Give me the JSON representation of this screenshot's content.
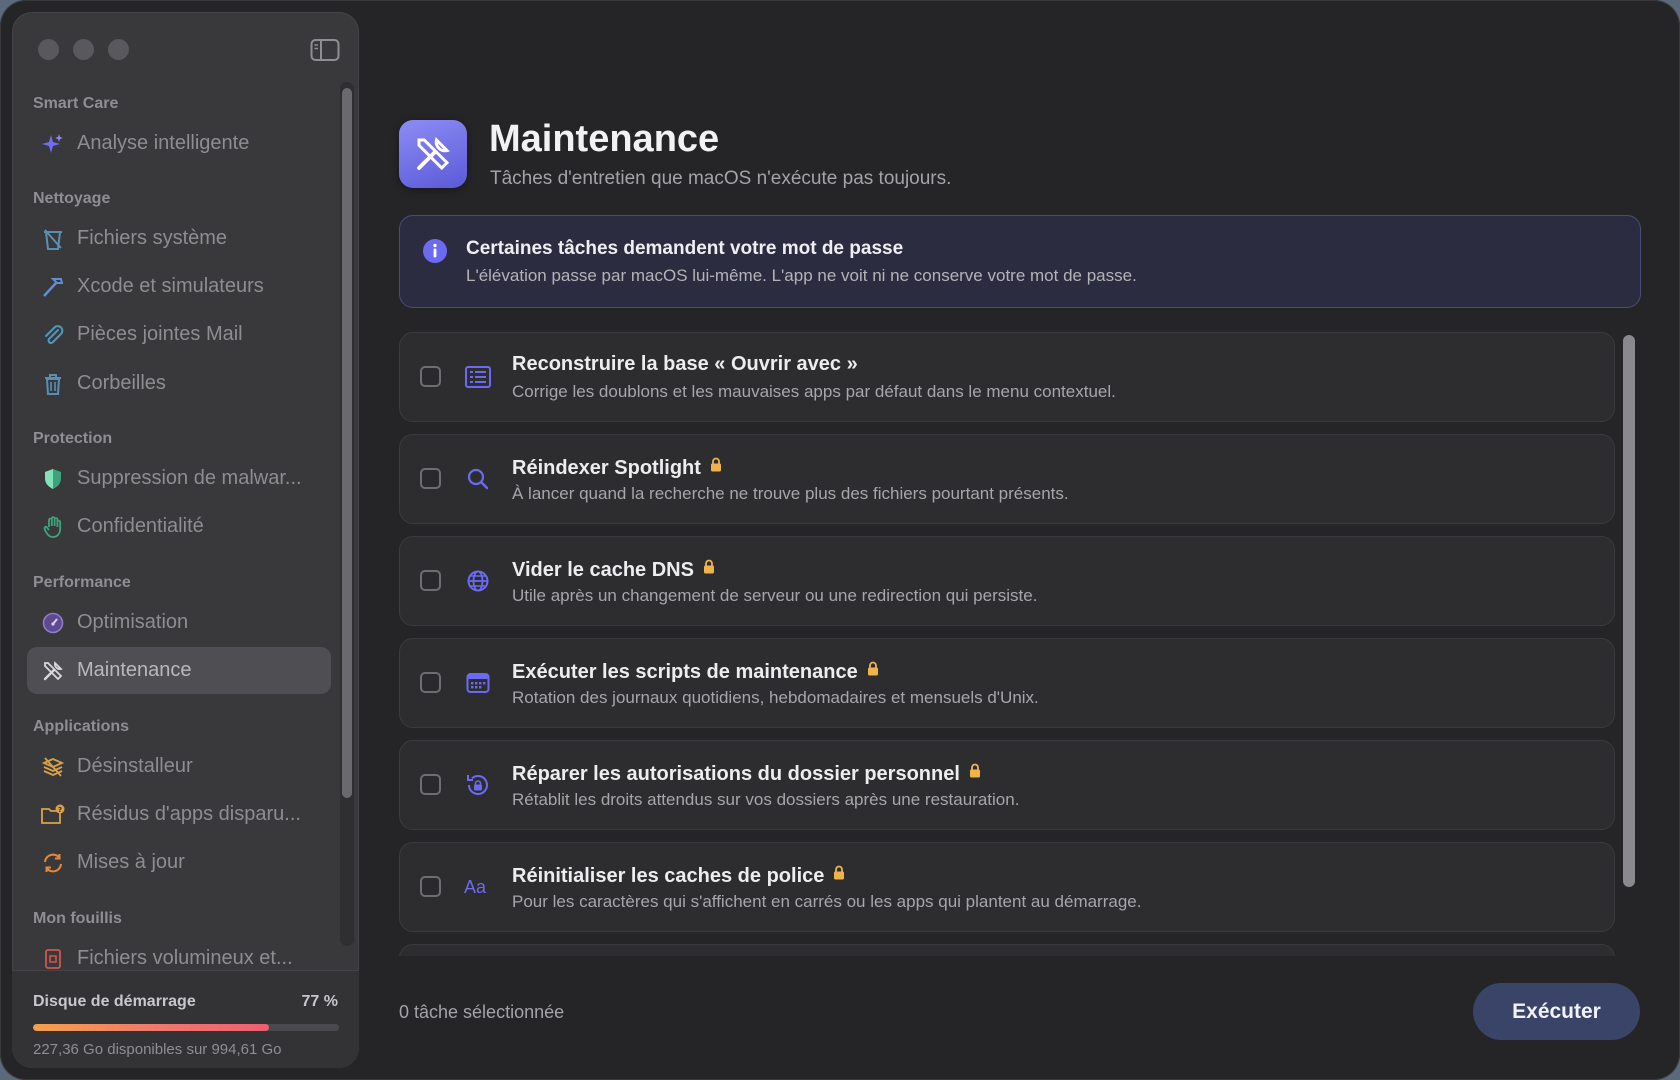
{
  "sidebar": {
    "sections": [
      {
        "title": "Smart Care",
        "items": [
          {
            "label": "Analyse intelligente",
            "icon": "sparkles-icon"
          }
        ]
      },
      {
        "title": "Nettoyage",
        "items": [
          {
            "label": "Fichiers système",
            "icon": "trash-doc-icon"
          },
          {
            "label": "Xcode et simulateurs",
            "icon": "hammer-icon"
          },
          {
            "label": "Pièces jointes Mail",
            "icon": "paperclip-icon"
          },
          {
            "label": "Corbeilles",
            "icon": "trash-icon"
          }
        ]
      },
      {
        "title": "Protection",
        "items": [
          {
            "label": "Suppression de malwar...",
            "icon": "shield-icon"
          },
          {
            "label": "Confidentialité",
            "icon": "hand-icon"
          }
        ]
      },
      {
        "title": "Performance",
        "items": [
          {
            "label": "Optimisation",
            "icon": "gauge-icon"
          },
          {
            "label": "Maintenance",
            "icon": "tools-icon",
            "selected": true
          }
        ]
      },
      {
        "title": "Applications",
        "items": [
          {
            "label": "Désinstalleur",
            "icon": "uninstall-icon"
          },
          {
            "label": "Résidus d'apps disparu...",
            "icon": "folder-question-icon"
          },
          {
            "label": "Mises à jour",
            "icon": "refresh-icon"
          }
        ]
      },
      {
        "title": "Mon fouillis",
        "items": [
          {
            "label": "Fichiers volumineux et...",
            "icon": "large-file-icon"
          }
        ]
      }
    ],
    "disk": {
      "title": "Disque de démarrage",
      "percent_label": "77 %",
      "used_fraction": 0.77,
      "free_label": "227,36 Go disponibles sur 994,61 Go"
    }
  },
  "header": {
    "title": "Maintenance",
    "subtitle": "Tâches d'entretien que macOS n'exécute pas toujours."
  },
  "banner": {
    "title": "Certaines tâches demandent votre mot de passe",
    "text": "L'élévation passe par macOS lui-même. L'app ne voit ni ne conserve votre mot de passe."
  },
  "tasks": [
    {
      "title": "Reconstruire la base « Ouvrir avec »",
      "desc": "Corrige les doublons et les mauvaises apps par défaut dans le menu contextuel.",
      "locked": false,
      "checked": false,
      "icon": "list-icon"
    },
    {
      "title": "Réindexer Spotlight",
      "desc": "À lancer quand la recherche ne trouve plus des fichiers pourtant présents.",
      "locked": true,
      "checked": false,
      "icon": "search-icon"
    },
    {
      "title": "Vider le cache DNS",
      "desc": "Utile après un changement de serveur ou une redirection qui persiste.",
      "locked": true,
      "checked": false,
      "icon": "globe-icon"
    },
    {
      "title": "Exécuter les scripts de maintenance",
      "desc": "Rotation des journaux quotidiens, hebdomadaires et mensuels d'Unix.",
      "locked": true,
      "checked": false,
      "icon": "calendar-icon"
    },
    {
      "title": "Réparer les autorisations du dossier personnel",
      "desc": "Rétablit les droits attendus sur vos dossiers après une restauration.",
      "locked": true,
      "checked": false,
      "icon": "lock-rotate-icon"
    },
    {
      "title": "Réinitialiser les caches de police",
      "desc": "Pour les caractères qui s'affichent en carrés ou les apps qui plantent au démarrage.",
      "locked": true,
      "checked": false,
      "icon": "font-icon"
    }
  ],
  "footer": {
    "status": "0 tâche sélectionnée",
    "run_label": "Exécuter"
  },
  "colors": {
    "accent": "#6b6af0",
    "lock": "#f0b34a",
    "run_button": "#3a4468"
  }
}
